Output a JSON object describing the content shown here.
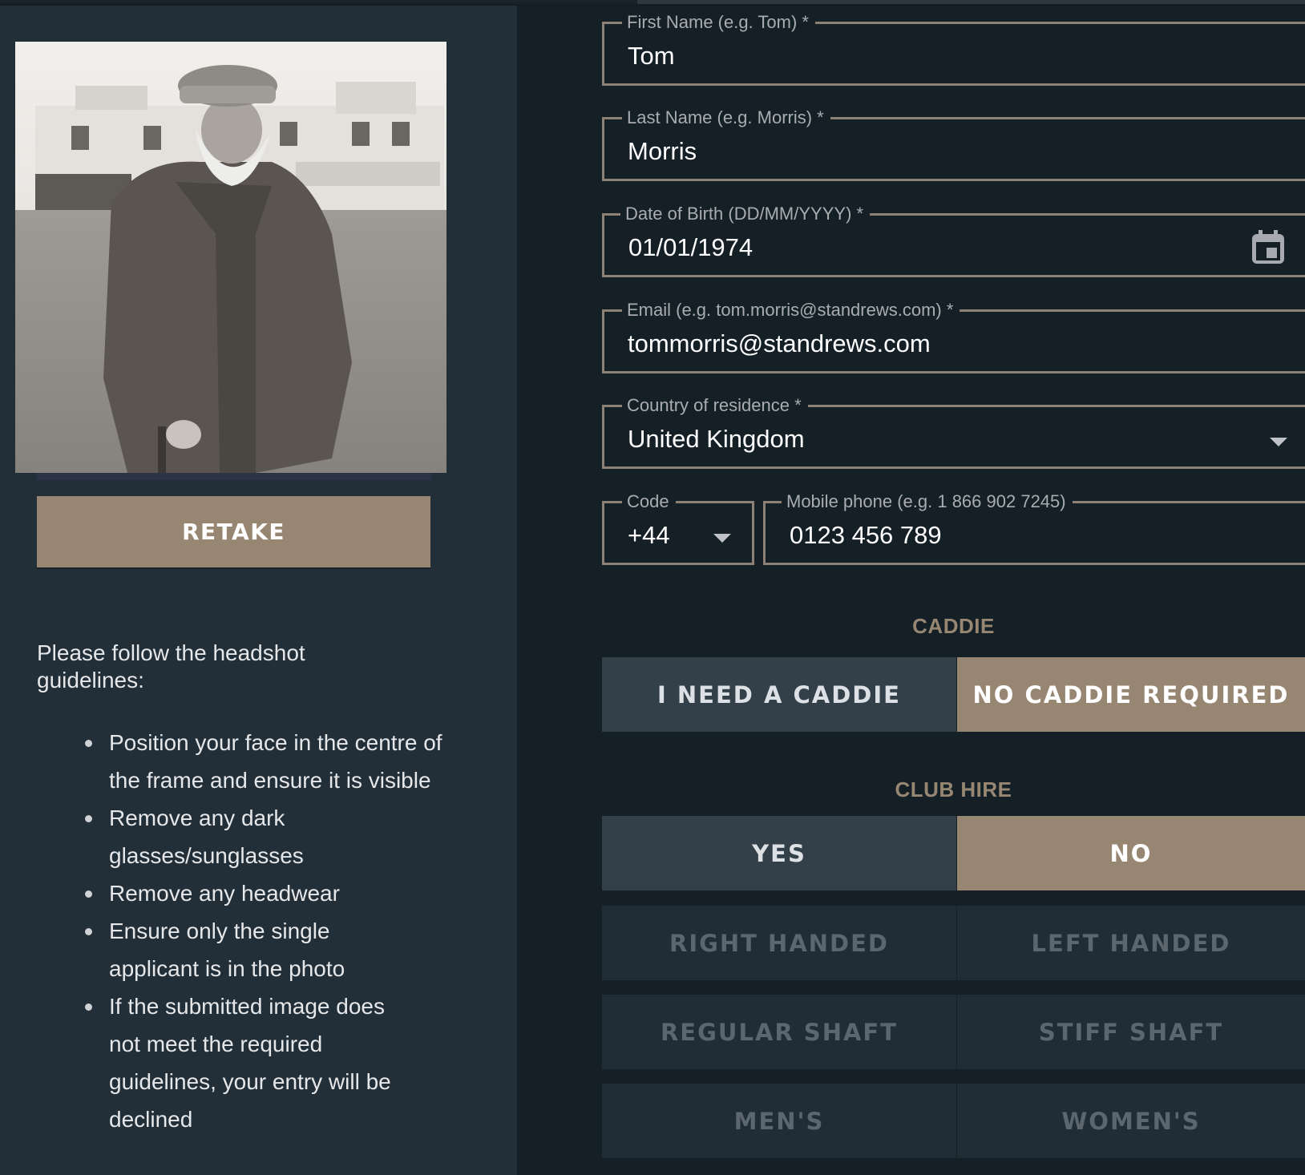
{
  "colors": {
    "accent": "#978772",
    "background": "#141f26",
    "left_panel": "#232f38",
    "segment_unselected": "#33404a",
    "segment_disabled": "#202d37",
    "field_border": "#8c8174"
  },
  "headshot": {
    "image_alt": "Black and white headshot photo of bearded man in flat cap in front of clubhouse",
    "retake_label": "RETAKE",
    "guidelines_intro": "Please follow the headshot guidelines:",
    "guidelines": [
      "Position your face in the centre of the frame and ensure it is visible",
      "Remove any dark glasses/sunglasses",
      "Remove any headwear",
      "Ensure only the single applicant is in the photo",
      "If the submitted image does not meet the required guidelines, your entry will be declined"
    ]
  },
  "form": {
    "first_name": {
      "label": "First Name (e.g. Tom) *",
      "value": "Tom"
    },
    "last_name": {
      "label": "Last Name (e.g. Morris) *",
      "value": "Morris"
    },
    "dob": {
      "label": "Date of Birth (DD/MM/YYYY) *",
      "value": "01/01/1974",
      "icon": "calendar-icon"
    },
    "email": {
      "label": "Email (e.g. tom.morris@standrews.com) *",
      "value": "tommorris@standrews.com"
    },
    "country": {
      "label": "Country of residence *",
      "value": "United Kingdom",
      "icon": "chevron-down-icon"
    },
    "code": {
      "label": "Code",
      "value": "+44",
      "icon": "chevron-down-icon"
    },
    "mobile": {
      "label": "Mobile phone (e.g. 1 866 902 7245)",
      "value": "0123 456 789"
    }
  },
  "caddie": {
    "title": "CADDIE",
    "options": [
      {
        "label": "I NEED A CADDIE",
        "selected": false
      },
      {
        "label": "NO CADDIE REQUIRED",
        "selected": true
      }
    ]
  },
  "club_hire": {
    "title": "CLUB HIRE",
    "options": [
      {
        "label": "YES",
        "selected": false
      },
      {
        "label": "NO",
        "selected": true
      }
    ],
    "handedness": [
      {
        "label": "RIGHT HANDED",
        "disabled": true
      },
      {
        "label": "LEFT HANDED",
        "disabled": true
      }
    ],
    "shaft": [
      {
        "label": "REGULAR SHAFT",
        "disabled": true
      },
      {
        "label": "STIFF SHAFT",
        "disabled": true
      }
    ],
    "gender": [
      {
        "label": "MEN'S",
        "disabled": true
      },
      {
        "label": "WOMEN'S",
        "disabled": true
      }
    ]
  }
}
